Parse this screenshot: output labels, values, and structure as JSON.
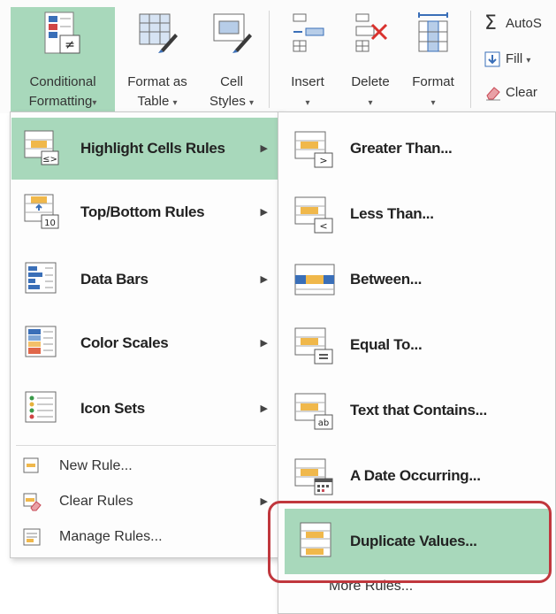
{
  "ribbon": {
    "conditional_formatting": {
      "line1": "Conditional",
      "line2": "Formatting"
    },
    "format_as_table": {
      "line1": "Format as",
      "line2": "Table"
    },
    "cell_styles": {
      "line1": "Cell",
      "line2": "Styles"
    },
    "insert": "Insert",
    "delete": "Delete",
    "format": "Format",
    "autosum": "AutoS",
    "fill": "Fill",
    "clear": "Clear"
  },
  "menu": {
    "items": [
      {
        "label": "Highlight Cells Rules",
        "highlighted": true,
        "icon": "highlight-cells-icon"
      },
      {
        "label": "Top/Bottom Rules",
        "icon": "top-bottom-icon"
      },
      {
        "label": "Data Bars",
        "icon": "data-bars-icon"
      },
      {
        "label": "Color Scales",
        "icon": "color-scales-icon"
      },
      {
        "label": "Icon Sets",
        "icon": "icon-sets-icon"
      }
    ],
    "small_items": [
      {
        "label": "New Rule...",
        "icon": "new-rule-icon"
      },
      {
        "label": "Clear Rules",
        "icon": "clear-rules-icon"
      },
      {
        "label": "Manage Rules...",
        "icon": "manage-rules-icon"
      }
    ]
  },
  "submenu": {
    "items": [
      {
        "label": "Greater Than...",
        "icon": "greater-than-icon"
      },
      {
        "label": "Less Than...",
        "icon": "less-than-icon"
      },
      {
        "label": "Between...",
        "icon": "between-icon"
      },
      {
        "label": "Equal To...",
        "icon": "equal-to-icon"
      },
      {
        "label": "Text that Contains...",
        "icon": "text-contains-icon"
      },
      {
        "label": "A Date Occurring...",
        "icon": "date-occurring-icon"
      },
      {
        "label": "Duplicate Values...",
        "highlighted": true,
        "icon": "duplicate-values-icon"
      }
    ],
    "more_rules": "More Rules..."
  },
  "colors": {
    "highlight": "#a8d8bb",
    "ring": "#c0373d"
  }
}
